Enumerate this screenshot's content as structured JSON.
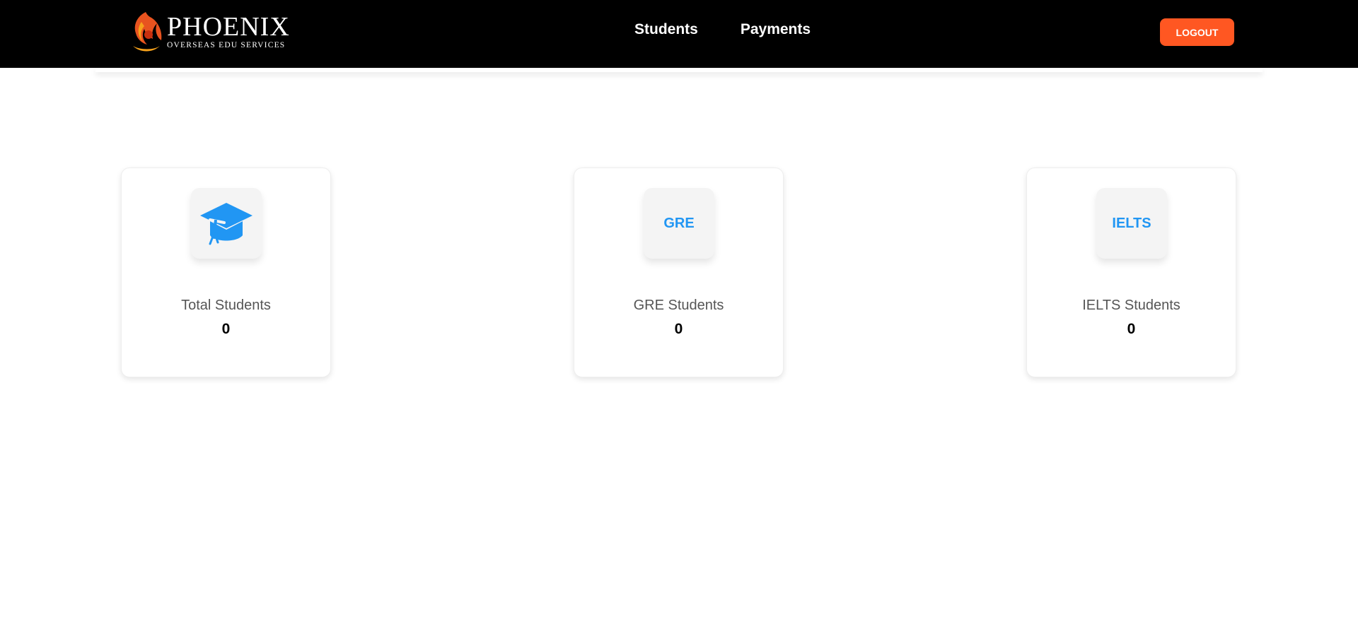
{
  "logo": {
    "title": "PHOENIX",
    "subtitle": "OVERSEAS EDU SERVICES",
    "icon": "phoenix-logo-icon"
  },
  "nav": {
    "links": [
      "Students",
      "Payments"
    ],
    "logout_label": "LOGOUT"
  },
  "colors": {
    "navbar_bg": "#000000",
    "logout_bg": "#ff5722",
    "icon_accent": "#2196f3"
  },
  "cards": [
    {
      "icon": "graduation-cap-icon",
      "icon_text": "",
      "label": "Total Students",
      "value": "0"
    },
    {
      "icon": "gre-icon",
      "icon_text": "GRE",
      "label": "GRE Students",
      "value": "0"
    },
    {
      "icon": "ielts-icon",
      "icon_text": "IELTS",
      "label": "IELTS Students",
      "value": "0"
    }
  ]
}
